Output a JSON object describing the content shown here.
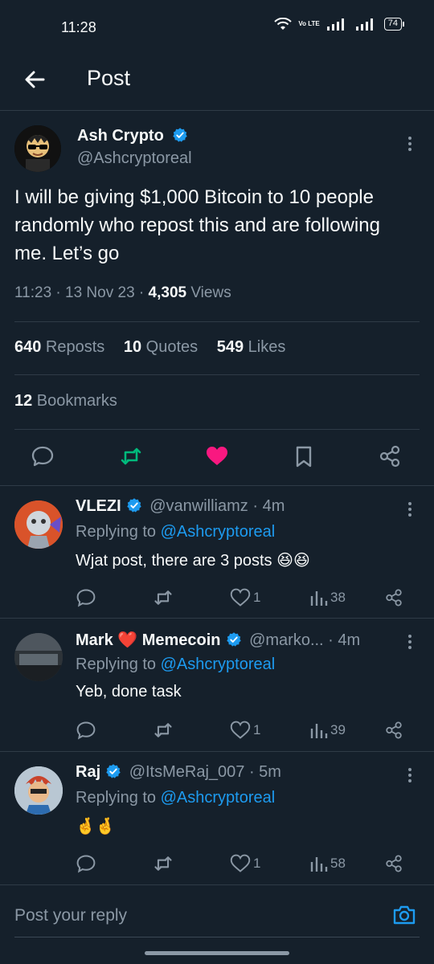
{
  "status_bar": {
    "time": "11:28",
    "battery": "74",
    "volte": "Vo LTE"
  },
  "header": {
    "title": "Post"
  },
  "post": {
    "author_name": "Ash Crypto",
    "author_handle": "@Ashcryptoreal",
    "text": "I will be giving $1,000 Bitcoin to 10 people randomly who repost this and are following me. Let’s go",
    "time": "11:23 · 13 Nov 23 · ",
    "views_count": "4,305",
    "views_label": " Views",
    "reposts_count": "640",
    "reposts_label": " Reposts",
    "quotes_count": "10",
    "quotes_label": " Quotes",
    "likes_count": "549",
    "likes_label": " Likes",
    "bookmarks_count": "12",
    "bookmarks_label": " Bookmarks",
    "liked": true
  },
  "replies": [
    {
      "name": "VLEZI",
      "handle": "@vanwilliamz",
      "time": " · 4m",
      "replying_label": "Replying to ",
      "mention": "@Ashcryptoreal",
      "text": "Wjat post, there are 3 posts 😆😆",
      "likes": "1",
      "views": "38"
    },
    {
      "name": "Mark ❤️ Memecoin",
      "handle": "@marko...",
      "time": " · 4m",
      "replying_label": "Replying to ",
      "mention": "@Ashcryptoreal",
      "text": "Yeb, done task",
      "likes": "1",
      "views": "39"
    },
    {
      "name": "Raj",
      "handle": "@ItsMeRaj_007",
      "time": " · 5m",
      "replying_label": "Replying to ",
      "mention": "@Ashcryptoreal",
      "text": "🤞🤞",
      "likes": "1",
      "views": "58"
    }
  ],
  "composer": {
    "placeholder": "Post your reply"
  },
  "colors": {
    "background": "#15202b",
    "accent": "#1d9bf0",
    "repost_green": "#00ba7c",
    "like_pink": "#f91880",
    "muted": "#8b98a5"
  }
}
